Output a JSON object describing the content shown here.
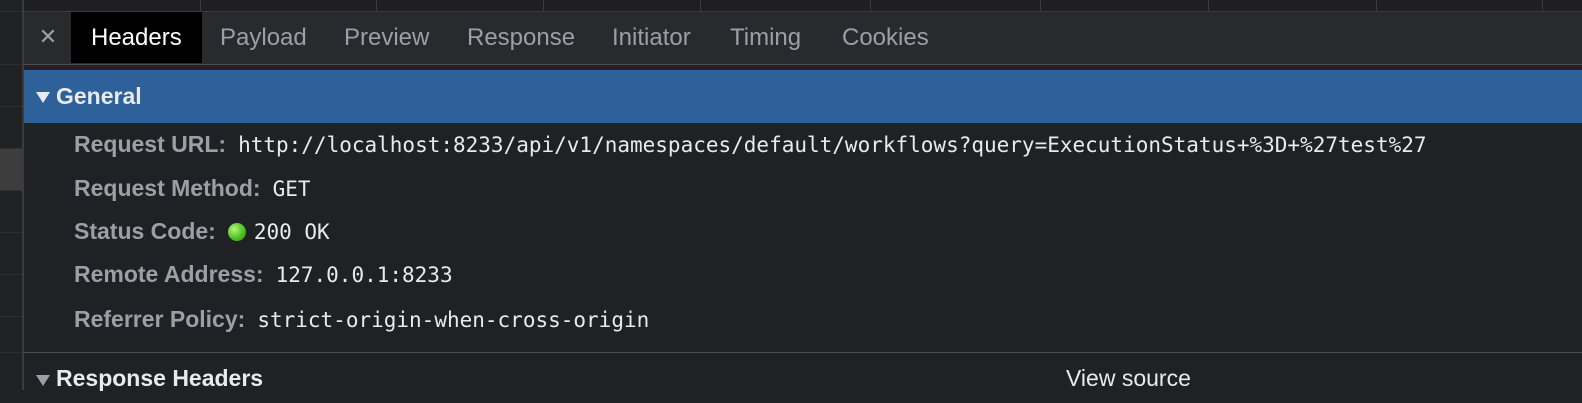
{
  "tabs": [
    {
      "label": "Headers",
      "active": true
    },
    {
      "label": "Payload",
      "active": false
    },
    {
      "label": "Preview",
      "active": false
    },
    {
      "label": "Response",
      "active": false
    },
    {
      "label": "Initiator",
      "active": false
    },
    {
      "label": "Timing",
      "active": false
    },
    {
      "label": "Cookies",
      "active": false
    }
  ],
  "close_icon": "close-icon",
  "general": {
    "title": "General",
    "request_url_label": "Request URL:",
    "request_url": "http://localhost:8233/api/v1/namespaces/default/workflows?query=ExecutionStatus+%3D+%27test%27",
    "request_method_label": "Request Method:",
    "request_method": "GET",
    "status_code_label": "Status Code:",
    "status_code": "200 OK",
    "status_color": "#4cc21f",
    "remote_address_label": "Remote Address:",
    "remote_address": "127.0.0.1:8233",
    "referrer_policy_label": "Referrer Policy:",
    "referrer_policy": "strict-origin-when-cross-origin"
  },
  "response_headers": {
    "title": "Response Headers",
    "view_source": "View source"
  },
  "colors": {
    "section_highlight": "#2e6099",
    "active_tab_bg": "#000000",
    "panel_bg": "#202124"
  }
}
